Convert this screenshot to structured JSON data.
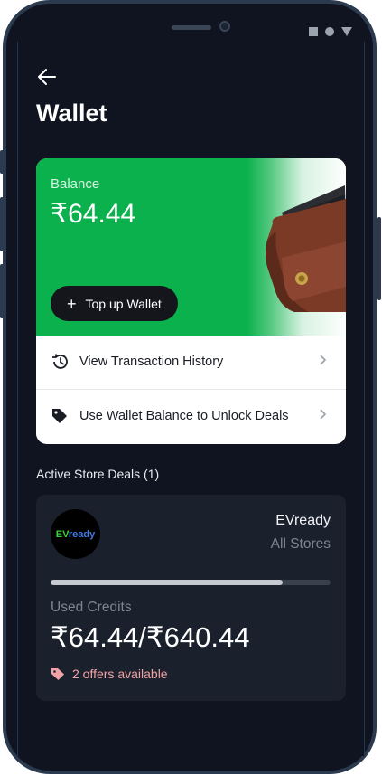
{
  "header": {
    "title": "Wallet"
  },
  "balance_card": {
    "label": "Balance",
    "amount": "₹64.44",
    "top_up_label": "Top up Wallet",
    "accent_color": "#0bb14c"
  },
  "menu": [
    {
      "label": "View Transaction History",
      "icon": "history-icon"
    },
    {
      "label": "Use Wallet Balance to Unlock Deals",
      "icon": "tag-icon"
    }
  ],
  "deals": {
    "section_title": "Active Store Deals (1)",
    "items": [
      {
        "logo_text_e": "EV",
        "logo_text_r": "ready",
        "store_name": "EVready",
        "scope": "All Stores",
        "progress_fraction": 0.83,
        "used_label": "Used Credits",
        "used_value": "₹64.44/₹640.44",
        "offers_text": "2 offers available"
      }
    ]
  }
}
